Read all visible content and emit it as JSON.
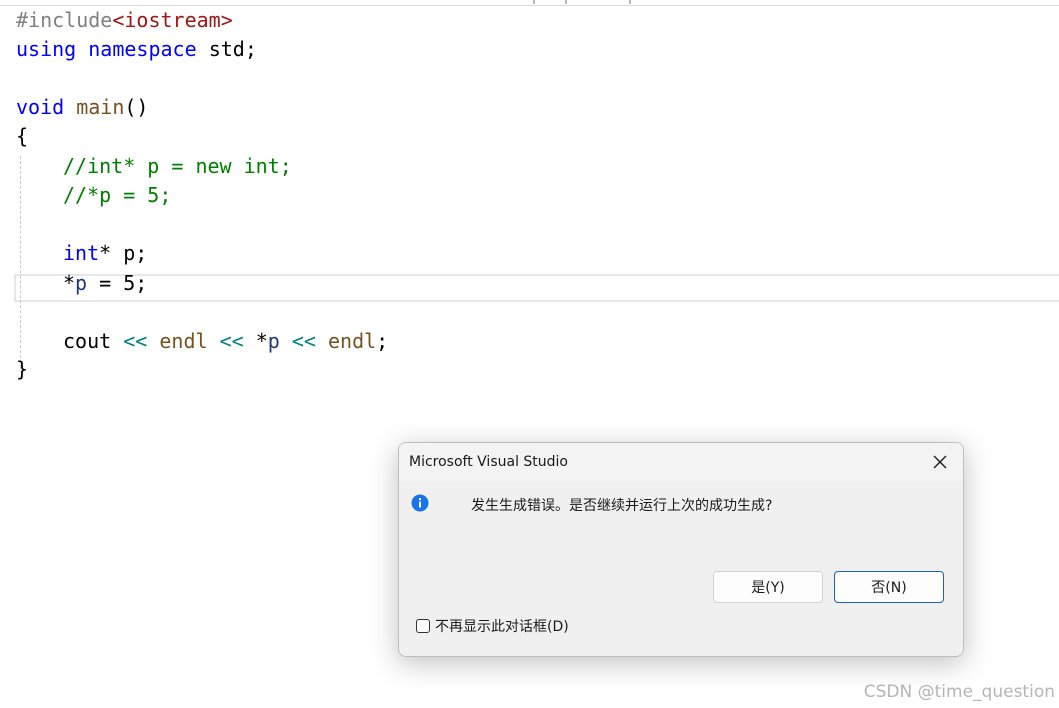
{
  "editor": {
    "line1": {
      "directive": "#include",
      "header": "<iostream>"
    },
    "line2": {
      "using": "using",
      "namespace": "namespace",
      "name": "std",
      "semi": ";"
    },
    "line4": {
      "type": "void",
      "func": "main",
      "parens": "()"
    },
    "line5": {
      "brace": "{"
    },
    "line6": {
      "comment": "//int* p = new int;"
    },
    "line7": {
      "comment": "//*p = 5;"
    },
    "line9": {
      "type": "int",
      "rest": "* p;"
    },
    "line10": {
      "star": "*",
      "var": "p",
      "rest": " = 5;"
    },
    "line12": {
      "cout": "cout",
      "op1": "<<",
      "endl1": "endl",
      "op2": "<<",
      "star": "*",
      "var": "p",
      "op3": "<<",
      "endl2": "endl",
      "semi": ";"
    },
    "line13": {
      "brace": "}"
    }
  },
  "dialog": {
    "title": "Microsoft Visual Studio",
    "message": "发生生成错误。是否继续并运行上次的成功生成?",
    "yes_label": "是(Y)",
    "no_label": "否(N)",
    "checkbox_label": "不再显示此对话框(D)",
    "checkbox_checked": false,
    "info_icon": "info-icon",
    "close_icon": "close-icon"
  },
  "watermark": "CSDN @time_question",
  "colors": {
    "keyword": "#0000ff",
    "comment": "#008000",
    "string": "#a31515",
    "function": "#74531f",
    "preprocessor": "#808080",
    "operator": "#008080",
    "dialog_bg": "#f0f0f0",
    "info_blue": "#1a73e8",
    "focus_border": "#1f5fbf"
  }
}
